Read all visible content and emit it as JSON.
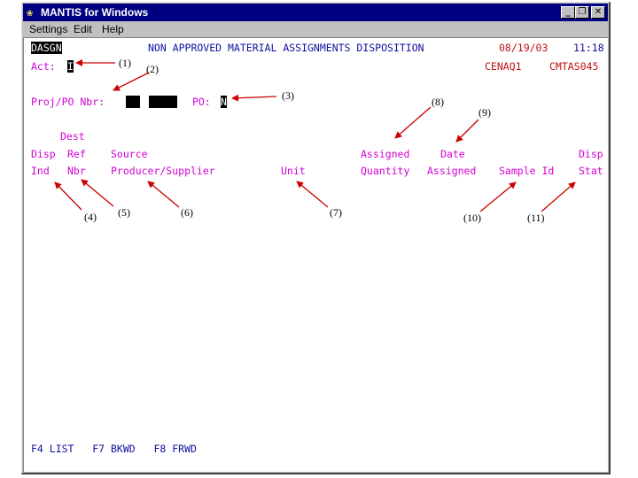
{
  "window": {
    "title": "MANTIS for Windows",
    "icon": "mantis-icon",
    "controls": {
      "minimize": "_",
      "restore": "❐",
      "close": "✕"
    }
  },
  "menu": [
    "Settings",
    "Edit",
    "Help"
  ],
  "screen": {
    "screen_id": "DASGN",
    "title": "NON APPROVED MATERIAL ASSIGNMENTS DISPOSITION",
    "date": "08/19/03",
    "time": "11:18",
    "region": "CENAQ1",
    "program": "CMTAS045",
    "act_label": "Act:",
    "act_value": "I",
    "proj_label": "Proj/PO Nbr:",
    "po_label": "PO:",
    "po_value": "N",
    "columns": {
      "disp_ind": [
        "Disp",
        "Ind"
      ],
      "dest_ref_nbr": [
        "Dest",
        "Ref",
        "Nbr"
      ],
      "source": [
        "Source",
        "Producer/Supplier"
      ],
      "unit": "Unit",
      "assigned_quantity": [
        "Assigned",
        "Quantity"
      ],
      "date_assigned": [
        "Date",
        "Assigned"
      ],
      "sample_id": "Sample Id",
      "disp_stat": [
        "Disp",
        "Stat"
      ]
    },
    "function_keys": "F4 LIST   F7 BKWD   F8 FRWD"
  },
  "callouts": [
    "(1)",
    "(2)",
    "(3)",
    "(4)",
    "(5)",
    "(6)",
    "(7)",
    "(8)",
    "(9)",
    "(10)",
    "(11)"
  ],
  "colors": {
    "title_bar": "#000080",
    "field_labels": "#d400d4",
    "header_text": "#1010a0",
    "status_text": "#c01010",
    "callout_arrows": "#cc0000"
  }
}
